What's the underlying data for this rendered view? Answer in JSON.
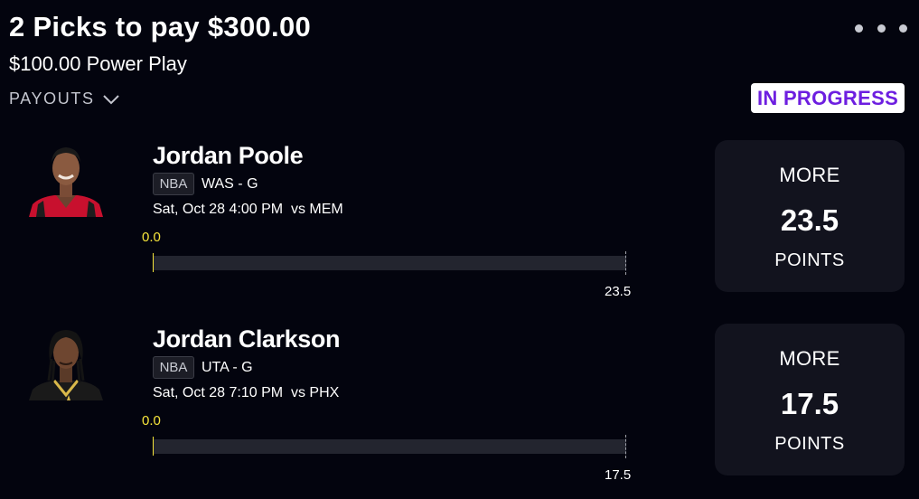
{
  "header": {
    "title": "2 Picks to pay $300.00",
    "subtitle": "$100.00 Power Play",
    "payouts_label": "PAYOUTS",
    "status": "IN PROGRESS",
    "menu_icon": "more-horizontal-icon"
  },
  "colors": {
    "background": "#03040e",
    "card": "#12131e",
    "status_text": "#6d1ee0",
    "progress_value": "#f7e53b"
  },
  "picks": [
    {
      "player": "Jordan Poole",
      "league": "NBA",
      "team_position": "WAS - G",
      "game_time": "Sat, Oct 28 4:00 PM",
      "opponent": "vs MEM",
      "current_value": "0.0",
      "line": "23.5",
      "progress_fraction": 0,
      "direction": "MORE",
      "stat": "POINTS",
      "jersey_color": "#c8102e"
    },
    {
      "player": "Jordan Clarkson",
      "league": "NBA",
      "team_position": "UTA - G",
      "game_time": "Sat, Oct 28 7:10 PM",
      "opponent": "vs PHX",
      "current_value": "0.0",
      "line": "17.5",
      "progress_fraction": 0,
      "direction": "MORE",
      "stat": "POINTS",
      "jersey_color": "#1a1a1a"
    }
  ]
}
